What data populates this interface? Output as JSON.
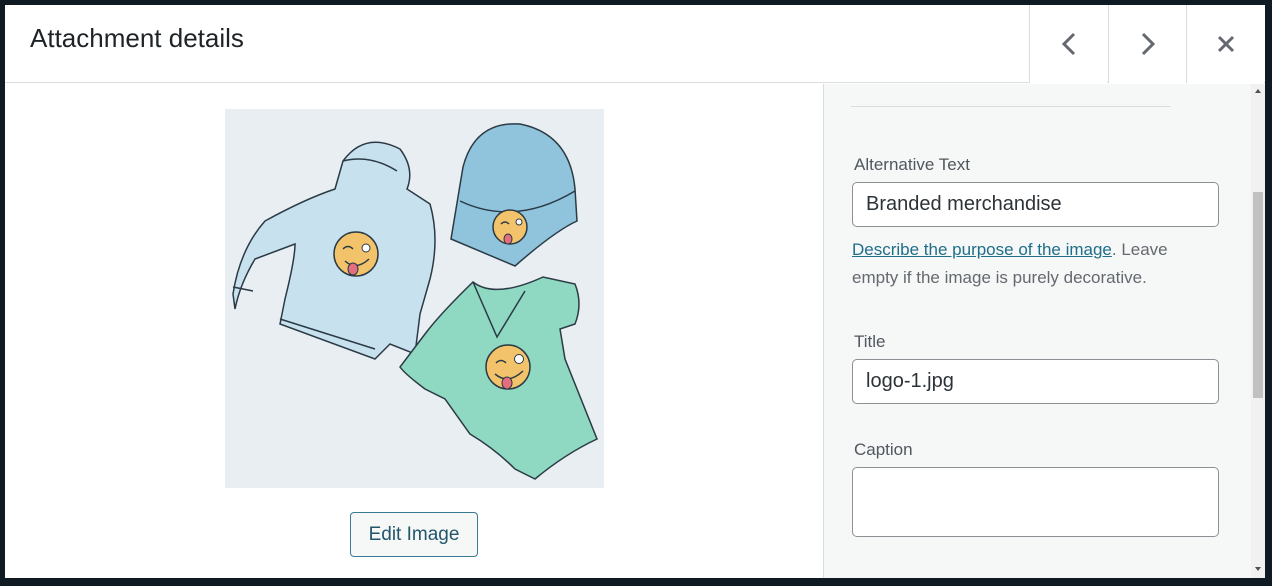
{
  "header": {
    "title": "Attachment details",
    "prev_icon": "chevron-left-icon",
    "next_icon": "chevron-right-icon",
    "close_icon": "close-icon"
  },
  "preview": {
    "image_alt": "Illustration of a light blue hoodie, a blue beanie and a green t-shirt each with a winking emoji logo",
    "edit_button_label": "Edit Image"
  },
  "sidebar": {
    "alt_text": {
      "label": "Alternative Text",
      "value": "Branded merchandise"
    },
    "help": {
      "link_text": "Describe the purpose of the image",
      "rest_text": ". Leave empty if the image is purely decorative."
    },
    "title": {
      "label": "Title",
      "value": "logo-1.jpg"
    },
    "caption": {
      "label": "Caption",
      "value": ""
    }
  },
  "colors": {
    "accent": "#2271b1",
    "link": "#1f6e8a",
    "panel_bg": "#f6f7f7",
    "border": "#dcdcde"
  }
}
